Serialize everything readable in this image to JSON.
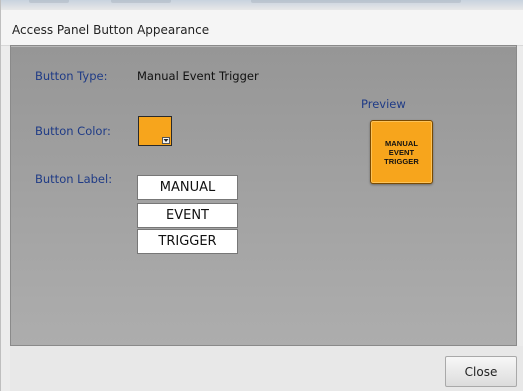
{
  "dialog": {
    "title": "Access Panel Button Appearance"
  },
  "fields": {
    "button_type_label": "Button Type:",
    "button_type_value": "Manual Event Trigger",
    "button_color_label": "Button Color:",
    "button_color_value": "#f7a51c",
    "button_label_label": "Button Label:",
    "label_lines": [
      "MANUAL",
      "EVENT",
      "TRIGGER"
    ]
  },
  "preview": {
    "title": "Preview",
    "lines": [
      "MANUAL",
      "EVENT",
      "TRIGGER"
    ],
    "color": "#f7a51c"
  },
  "footer": {
    "close_label": "Close"
  },
  "icons": {
    "color_dropdown": "chevron-down-icon"
  }
}
